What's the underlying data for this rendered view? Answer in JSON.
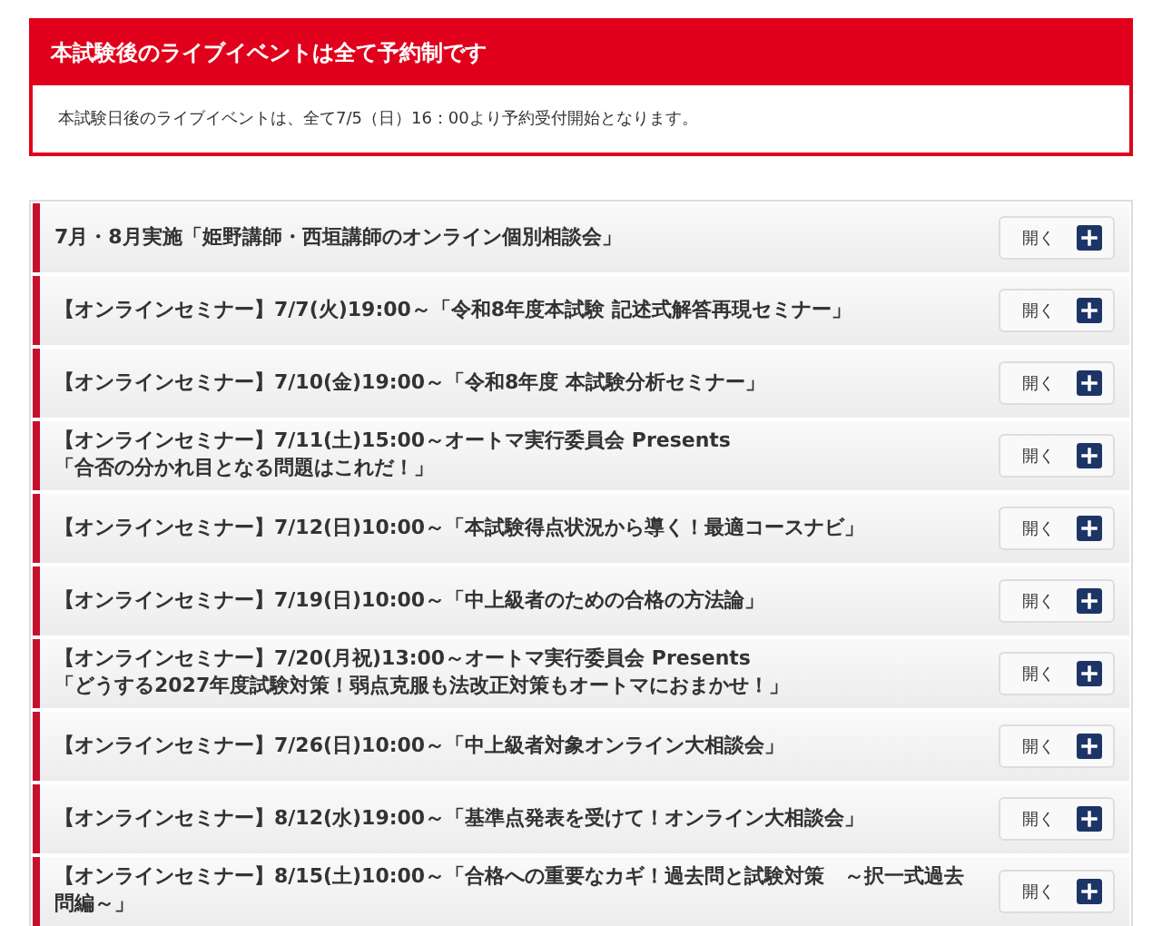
{
  "notice": {
    "title": "本試験後のライブイベントは全て予約制です",
    "body": "本試験日後のライブイベントは、全て7/5（日）16：00より予約受付開始となります。"
  },
  "events": [
    {
      "title": "7月・8月実施「姫野講師・西垣講師のオンライン個別相談会」",
      "button": "開く",
      "expanded": false
    },
    {
      "title": "【オンラインセミナー】7/7(火)19:00～「令和8年度本試験 記述式解答再現セミナー」",
      "button": "開く",
      "expanded": false
    },
    {
      "title": "【オンラインセミナー】7/10(金)19:00～「令和8年度 本試験分析セミナー」",
      "button": "開く",
      "expanded": false
    },
    {
      "title": "【オンラインセミナー】7/11(土)15:00～オートマ実行委員会 Presents\n「合否の分かれ目となる問題はこれだ！」",
      "button": "開く",
      "expanded": false
    },
    {
      "title": "【オンラインセミナー】7/12(日)10:00～「本試験得点状況から導く！最適コースナビ」",
      "button": "開く",
      "expanded": false
    },
    {
      "title": "【オンラインセミナー】7/19(日)10:00～「中上級者のための合格の方法論」",
      "button": "開く",
      "expanded": false
    },
    {
      "title": "【オンラインセミナー】7/20(月祝)13:00～オートマ実行委員会 Presents\n「どうする2027年度試験対策！弱点克服も法改正対策もオートマにおまかせ！」",
      "button": "開く",
      "expanded": false
    },
    {
      "title": "【オンラインセミナー】7/26(日)10:00～「中上級者対象オンライン大相談会」",
      "button": "開く",
      "expanded": false
    },
    {
      "title": "【オンラインセミナー】8/12(水)19:00～「基準点発表を受けて！オンライン大相談会」",
      "button": "開く",
      "expanded": false
    },
    {
      "title": "【オンラインセミナー】8/15(土)10:00～「合格への重要なカギ！過去問と試験対策　～択一式過去問編～」",
      "button": "開く",
      "expanded": false
    }
  ]
}
